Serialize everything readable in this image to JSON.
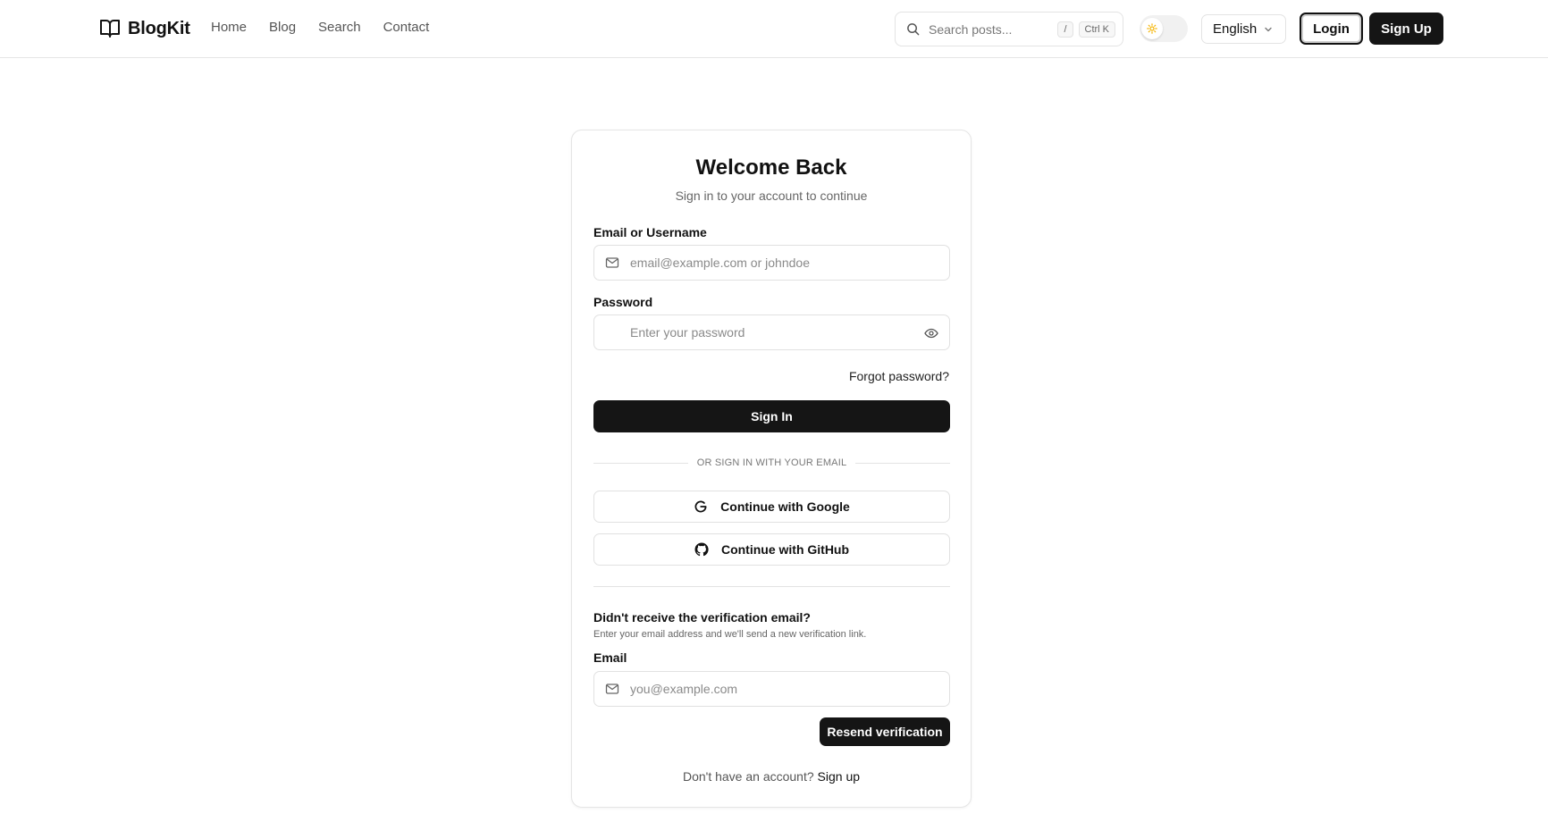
{
  "header": {
    "logo_text": "BlogKit",
    "nav": [
      "Home",
      "Blog",
      "Search",
      "Contact"
    ],
    "search": {
      "placeholder": "Search posts...",
      "kbd_slash": "/",
      "kbd_shortcut": "Ctrl K"
    },
    "language": "English",
    "login_label": "Login",
    "signup_label": "Sign Up"
  },
  "login_card": {
    "title": "Welcome Back",
    "subtitle": "Sign in to your account to continue",
    "email_label": "Email or Username",
    "email_placeholder": "email@example.com or johndoe",
    "password_label": "Password",
    "password_placeholder": "Enter your password",
    "forgot_link": "Forgot password?",
    "sign_in_button": "Sign In",
    "divider_text": "OR SIGN IN WITH YOUR EMAIL",
    "google_button": "Continue with Google",
    "github_button": "Continue with GitHub"
  },
  "resend": {
    "title": "Didn't receive the verification email?",
    "description": "Enter your email address and we'll send a new verification link.",
    "email_label": "Email",
    "email_placeholder": "you@example.com",
    "button": "Resend verification"
  },
  "footer": {
    "prompt": "Don't have an account?",
    "signup_link": "Sign up"
  },
  "colors": {
    "primary": "#151515",
    "border": "#e1e1e1",
    "muted_text": "#666666",
    "sun_icon": "#f5b400"
  }
}
